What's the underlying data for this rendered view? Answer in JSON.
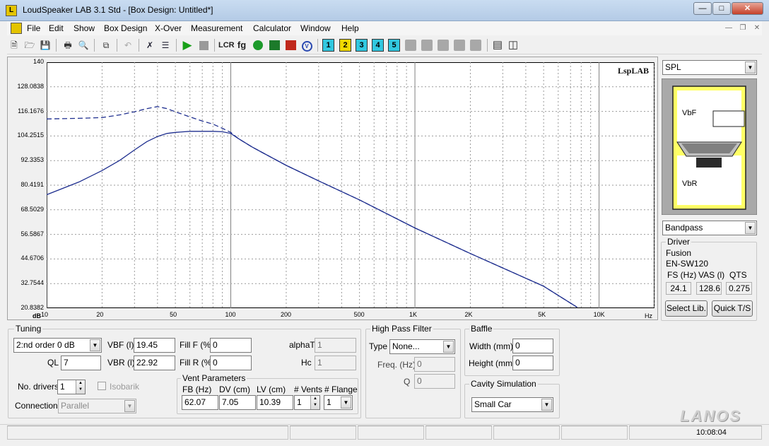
{
  "window": {
    "title": "LoudSpeaker LAB 3.1 Std - [Box Design: Untitled*]",
    "app_icon": "speaker-icon"
  },
  "menu": [
    "File",
    "Edit",
    "Show",
    "Box Design",
    "X-Over",
    "Measurement",
    "Calculator",
    "Window",
    "Help"
  ],
  "toolbar": {
    "layout_buttons": [
      "1",
      "2",
      "3",
      "4",
      "5"
    ],
    "lcr_label": "LCR",
    "fg_label": "fg"
  },
  "graph": {
    "watermark": "LspLAB",
    "y_unit": "dB",
    "x_unit": "Hz",
    "y_ticks": [
      "140",
      "128.0838",
      "116.1676",
      "104.2515",
      "92.3353",
      "80.4191",
      "68.5029",
      "56.5867",
      "44.6706",
      "32.7544",
      "20.8382"
    ],
    "x_ticks": [
      "10",
      "20",
      "50",
      "100",
      "200",
      "500",
      "1K",
      "2K",
      "5K",
      "10K"
    ],
    "line_color": "#1f2f8f"
  },
  "chart_data": {
    "type": "line",
    "title": "",
    "xlabel": "Hz",
    "ylabel": "dB",
    "x_scale": "log",
    "xlim": [
      10,
      20000
    ],
    "ylim": [
      20.8382,
      140
    ],
    "grid": true,
    "series": [
      {
        "style": "solid",
        "x": [
          10,
          15,
          20,
          25,
          30,
          35,
          40,
          45,
          50,
          60,
          70,
          80,
          90,
          100,
          110,
          130,
          150,
          200,
          300,
          500,
          1000,
          2000,
          5000,
          7600
        ],
        "y": [
          75.8,
          82,
          87.5,
          92.5,
          97.5,
          101.5,
          104,
          105.5,
          106,
          106.5,
          106.5,
          106.5,
          106.3,
          105.5,
          103,
          99,
          96,
          90,
          82.5,
          73.3,
          59.7,
          47.3,
          31.5,
          21.3
        ]
      },
      {
        "style": "dashed",
        "x": [
          10,
          15,
          20,
          25,
          30,
          35,
          40,
          45,
          50,
          60,
          70,
          80,
          90,
          100,
          110,
          130,
          150,
          200,
          300,
          500,
          1000,
          2000,
          5000,
          7600
        ],
        "y": [
          112.5,
          112.8,
          113.2,
          114.5,
          116,
          117.5,
          118.5,
          117.5,
          116,
          113.5,
          111.5,
          110,
          108,
          106,
          103,
          99,
          96,
          90,
          82.5,
          73.3,
          59.7,
          47.3,
          31.5,
          21.3
        ]
      }
    ]
  },
  "right_panel": {
    "view_select": "SPL",
    "box_labels": {
      "front": "VbF",
      "rear": "VbR"
    },
    "box_type": "Bandpass",
    "driver": {
      "group_title": "Driver",
      "manufacturer": "Fusion",
      "model": "EN-SW120",
      "fs_label": "FS (Hz)",
      "vas_label": "VAS (l)",
      "qts_label": "QTS",
      "fs": "24.1",
      "vas": "128.6",
      "qts": "0.275"
    },
    "select_lib": "Select Lib.",
    "quick_ts": "Quick T/S"
  },
  "tuning": {
    "title": "Tuning",
    "order": "2:nd order  0 dB",
    "vbf_label": "VBF (l)",
    "vbf": "19.45",
    "vbr_label": "VBR (l)",
    "vbr": "22.92",
    "fillf_label": "Fill F (%)",
    "fillf": "0",
    "fillr_label": "Fill R (%)",
    "fillr": "0",
    "alpha_label": "alphaT",
    "alpha": "1",
    "hc_label": "Hc",
    "hc": "1",
    "ql_label": "QL",
    "ql": "7",
    "drivers_label": "No. drivers",
    "drivers": "1",
    "isobarik_label": "Isobarik",
    "connection_label": "Connection",
    "connection": "Parallel",
    "vent": {
      "title": "Vent Parameters",
      "fb_label": "FB (Hz)",
      "dv_label": "DV (cm)",
      "lv_label": "LV (cm)",
      "vents_label": "# Vents",
      "flange_label": "# Flange",
      "fb": "62.07",
      "dv": "7.05",
      "lv": "10.39",
      "vents": "1",
      "flange": "1"
    }
  },
  "hpf": {
    "title": "High Pass Filter",
    "type_label": "Type",
    "type": "None...",
    "freq_label": "Freq. (Hz)",
    "freq": "0",
    "q_label": "Q",
    "q": "0"
  },
  "baffle": {
    "title": "Baffle",
    "width_label": "Width (mm)",
    "width": "0",
    "height_label": "Height (mm)",
    "height": "0"
  },
  "cavity": {
    "title": "Cavity Simulation",
    "value": "Small Car"
  },
  "status": {
    "clock": "10:08:04",
    "brand_logo": "LANOS"
  }
}
